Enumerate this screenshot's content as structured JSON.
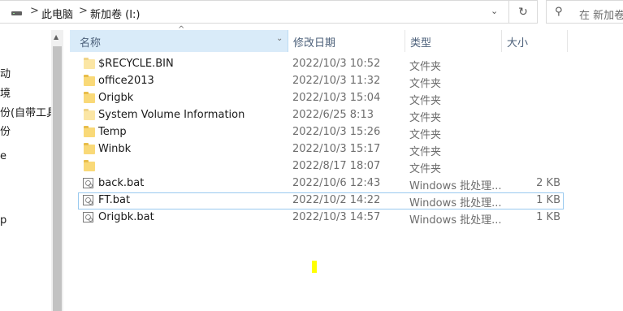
{
  "address": {
    "sep1": ">",
    "crumb1": "此电脑",
    "sep2": ">",
    "crumb2": "新加卷 (I:)",
    "dropdown": "⌄",
    "refresh": "↻"
  },
  "search": {
    "icon": "⚲",
    "placeholder": "在 新加卷"
  },
  "nav": {
    "items": [
      "动",
      "境",
      "份(自带工具)",
      "份",
      "e",
      "p"
    ]
  },
  "columns": {
    "name": "名称",
    "date": "修改日期",
    "type": "类型",
    "size": "大小",
    "sort_glyph": "^",
    "dd_glyph": "⌄"
  },
  "files": [
    {
      "name": "$RECYCLE.BIN",
      "date": "2022/10/3 10:52",
      "type": "文件夹",
      "size": "",
      "icon": "folder-light-icon"
    },
    {
      "name": "office2013",
      "date": "2022/10/3 11:32",
      "type": "文件夹",
      "size": "",
      "icon": "folder-icon"
    },
    {
      "name": "Origbk",
      "date": "2022/10/3 15:04",
      "type": "文件夹",
      "size": "",
      "icon": "folder-icon"
    },
    {
      "name": "System Volume Information",
      "date": "2022/6/25 8:13",
      "type": "文件夹",
      "size": "",
      "icon": "folder-light-icon"
    },
    {
      "name": "Temp",
      "date": "2022/10/3 15:26",
      "type": "文件夹",
      "size": "",
      "icon": "folder-icon"
    },
    {
      "name": "Winbk",
      "date": "2022/10/3 15:17",
      "type": "文件夹",
      "size": "",
      "icon": "folder-icon"
    },
    {
      "name": "",
      "date": "2022/8/17 18:07",
      "type": "文件夹",
      "size": "",
      "icon": "folder-icon"
    },
    {
      "name": "back.bat",
      "date": "2022/10/6 12:43",
      "type": "Windows 批处理...",
      "size": "2 KB",
      "icon": "batch-file-icon"
    },
    {
      "name": "FT.bat",
      "date": "2022/10/2 14:22",
      "type": "Windows 批处理...",
      "size": "1 KB",
      "icon": "batch-file-icon"
    },
    {
      "name": "Origbk.bat",
      "date": "2022/10/3 14:57",
      "type": "Windows 批处理...",
      "size": "1 KB",
      "icon": "batch-file-icon"
    }
  ]
}
